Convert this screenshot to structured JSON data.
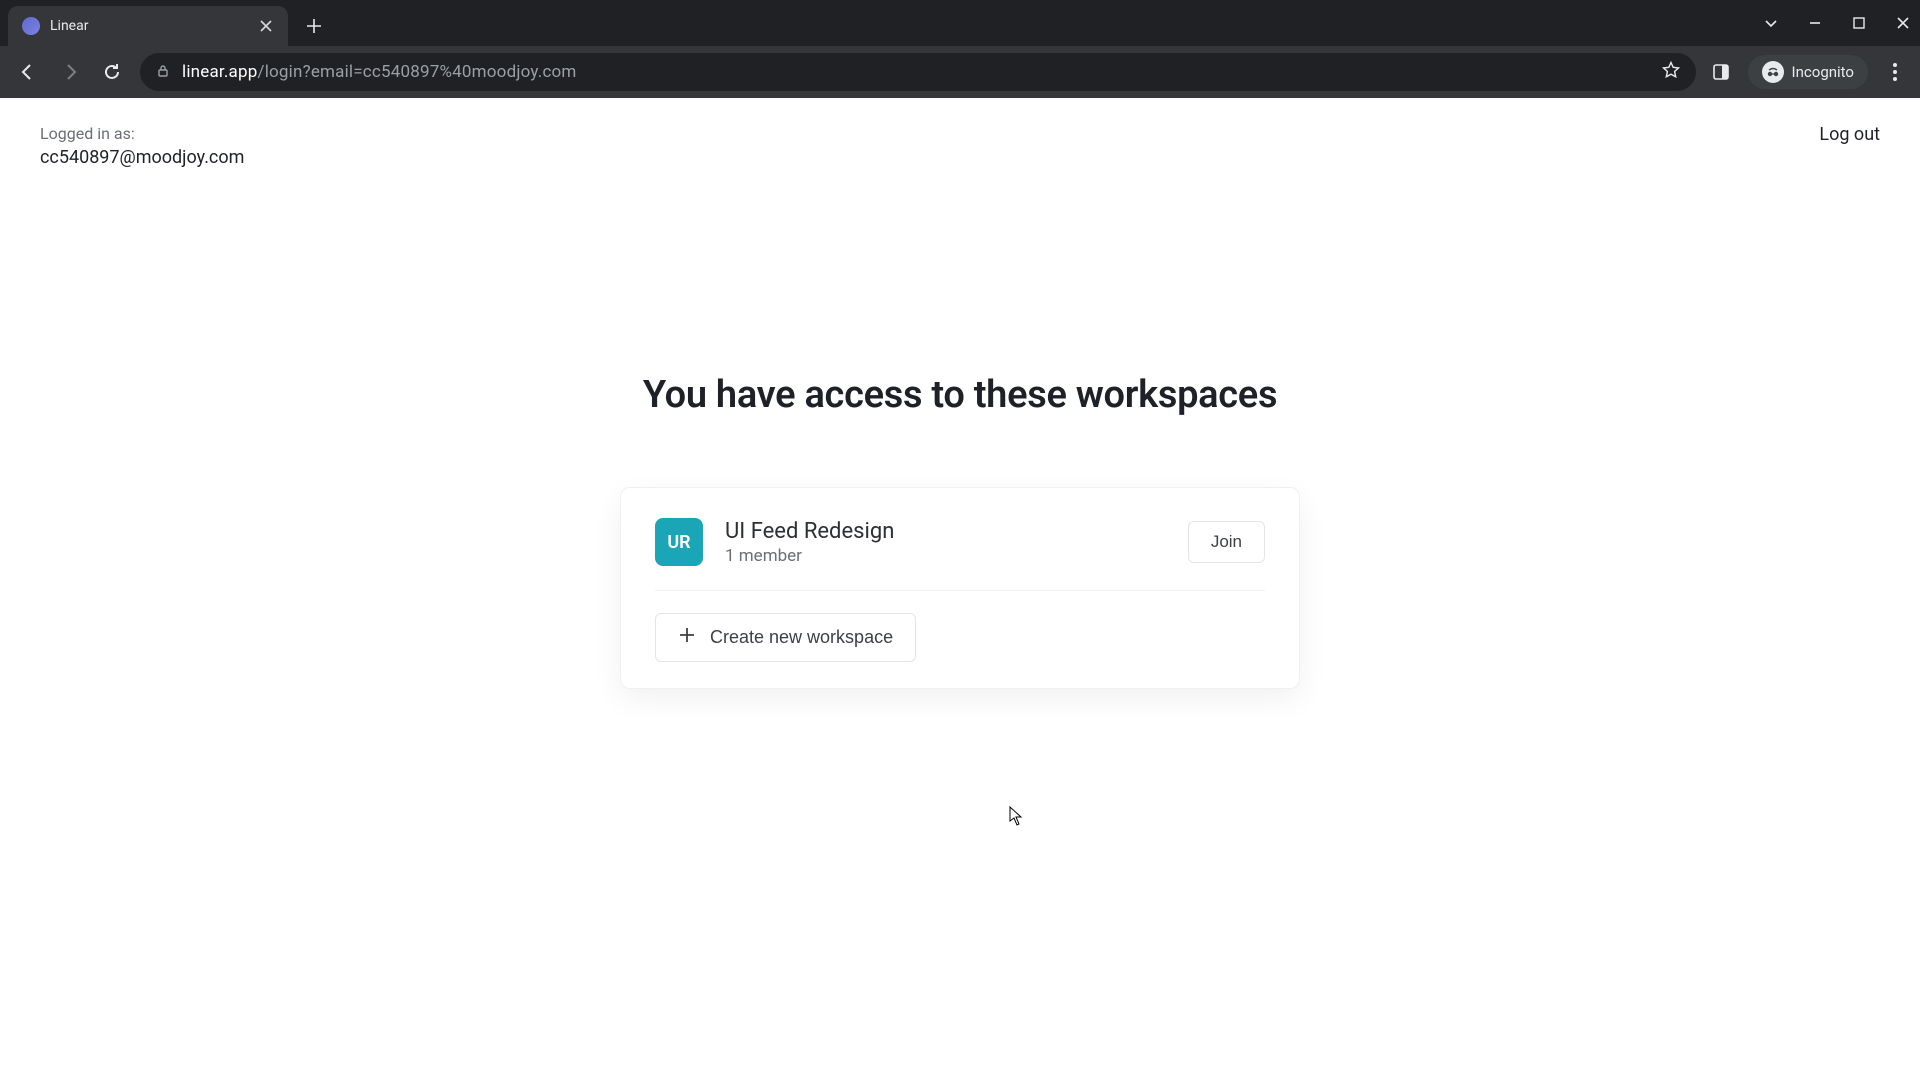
{
  "browser": {
    "tab_title": "Linear",
    "url_host": "linear.app",
    "url_path": "/login?email=cc540897%40moodjoy.com",
    "incognito_label": "Incognito"
  },
  "header": {
    "logged_in_label": "Logged in as:",
    "logged_in_email": "cc540897@moodjoy.com",
    "logout_label": "Log out"
  },
  "main": {
    "heading": "You have access to these workspaces",
    "workspaces": [
      {
        "avatar_initials": "UR",
        "name": "UI Feed Redesign",
        "members_text": "1 member",
        "join_label": "Join"
      }
    ],
    "create_label": "Create new workspace"
  }
}
